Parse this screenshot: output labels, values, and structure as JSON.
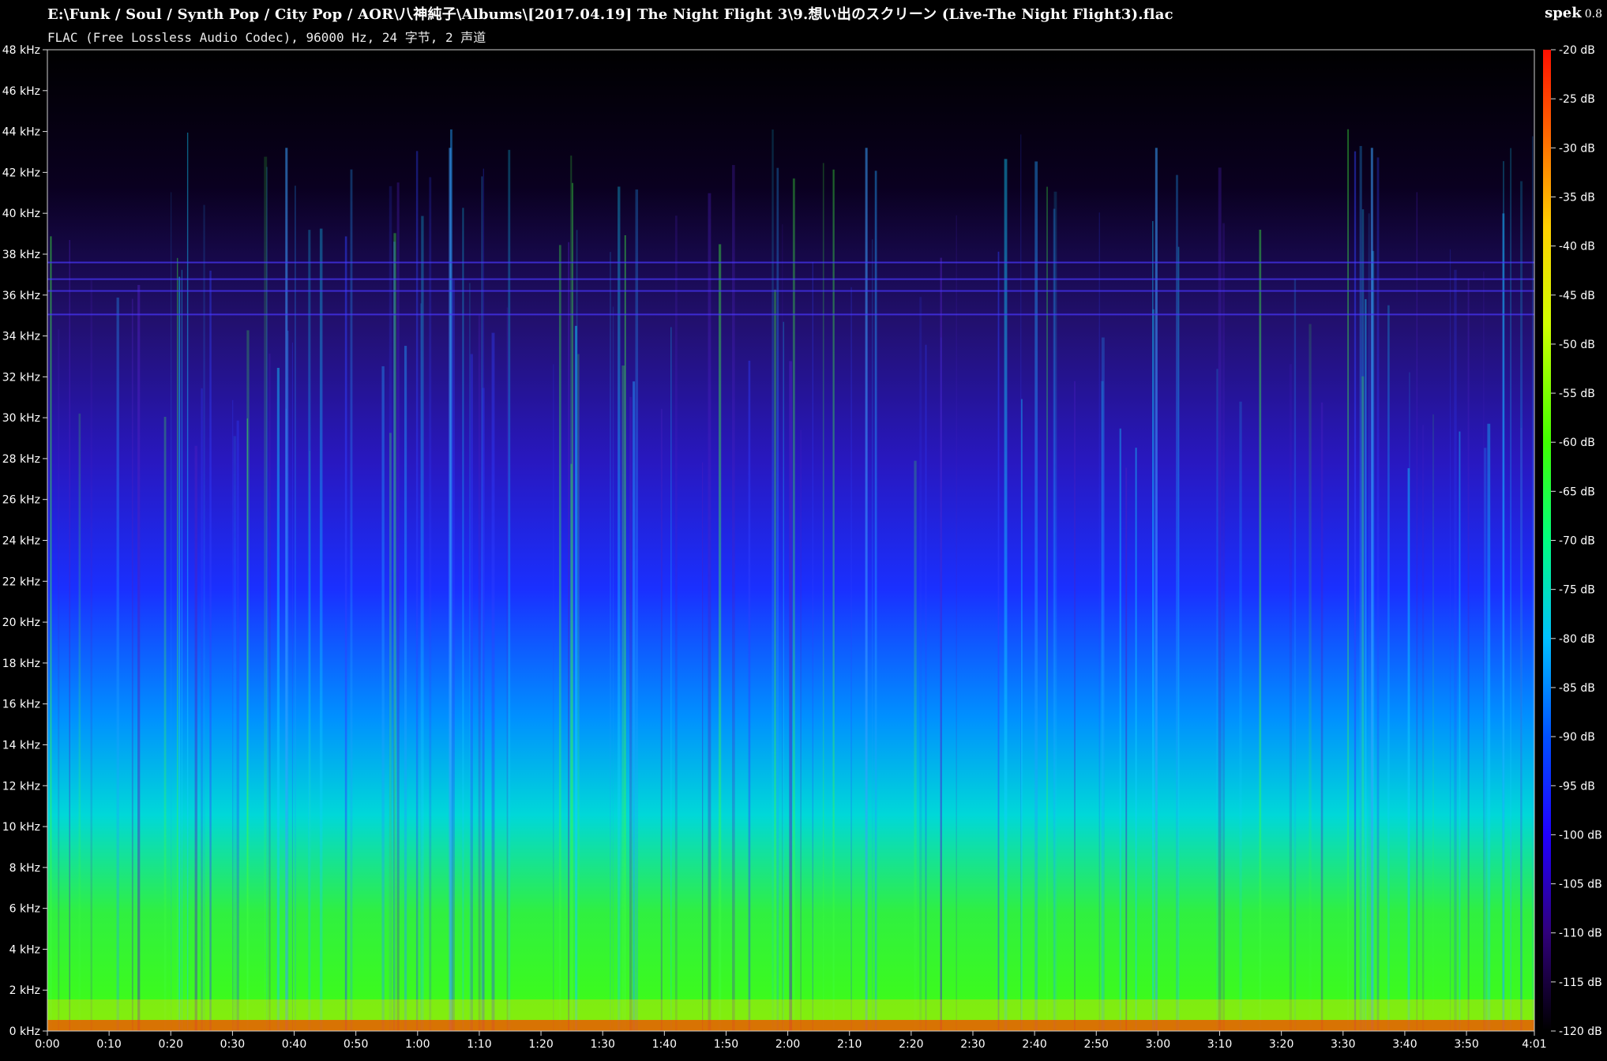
{
  "header": {
    "file_path": "E:\\Funk / Soul / Synth Pop / City Pop / AOR\\八神純子\\Albums\\[2017.04.19] The Night Flight 3\\9.想い出のスクリーン (Live-The Night Flight3).flac",
    "audio_info": "FLAC (Free Lossless Audio Codec), 96000 Hz, 24 字节, 2 声道",
    "app_name": "spek",
    "app_version": "0.8"
  },
  "chart_data": {
    "type": "heatmap",
    "title": "",
    "xlabel": "",
    "ylabel": "",
    "frequency_axis": {
      "unit": "kHz",
      "range": [
        0,
        48
      ],
      "ticks": [
        "0 kHz",
        "2 kHz",
        "4 kHz",
        "6 kHz",
        "8 kHz",
        "10 kHz",
        "12 kHz",
        "14 kHz",
        "16 kHz",
        "18 kHz",
        "20 kHz",
        "22 kHz",
        "24 kHz",
        "26 kHz",
        "28 kHz",
        "30 kHz",
        "32 kHz",
        "34 kHz",
        "36 kHz",
        "38 kHz",
        "40 kHz",
        "42 kHz",
        "44 kHz",
        "46 kHz",
        "48 kHz"
      ]
    },
    "time_axis": {
      "range_seconds": [
        0,
        241
      ],
      "ticks": [
        "0:00",
        "0:10",
        "0:20",
        "0:30",
        "0:40",
        "0:50",
        "1:00",
        "1:10",
        "1:20",
        "1:30",
        "1:40",
        "1:50",
        "2:00",
        "2:10",
        "2:20",
        "2:30",
        "2:40",
        "2:50",
        "3:00",
        "3:10",
        "3:20",
        "3:30",
        "3:40",
        "3:50",
        "4:01"
      ]
    },
    "db_scale": {
      "range": [
        -120,
        -20
      ],
      "ticks": [
        "-20 dB",
        "-25 dB",
        "-30 dB",
        "-35 dB",
        "-40 dB",
        "-45 dB",
        "-50 dB",
        "-55 dB",
        "-60 dB",
        "-65 dB",
        "-70 dB",
        "-75 dB",
        "-80 dB",
        "-85 dB",
        "-90 dB",
        "-95 dB",
        "-100 dB",
        "-105 dB",
        "-110 dB",
        "-115 dB",
        "-120 dB"
      ]
    },
    "colors": {
      "background": "#000000",
      "low": "#1a0040",
      "mid_low": "#2a18d0",
      "mid": "#00c8ff",
      "mid_high": "#40ff00",
      "high": "#ffe000",
      "peak": "#ff2000"
    }
  }
}
